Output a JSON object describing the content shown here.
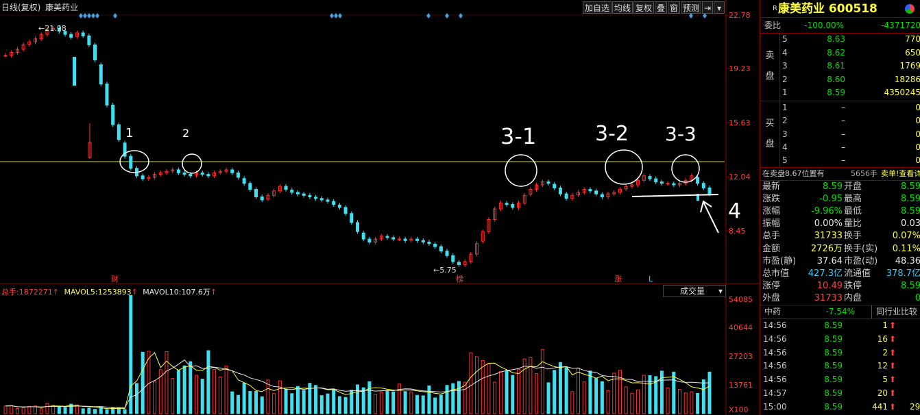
{
  "header": {
    "period_label": "日线(复权)",
    "stock_name": "康美药业",
    "buttons": [
      "加自选",
      "均线",
      "复权",
      "叠",
      "窗",
      "预测"
    ]
  },
  "price_axis": [
    "22.78",
    "19.23",
    "15.63",
    "12.04",
    "8.45"
  ],
  "volume_axis": [
    "54085",
    "40644",
    "27203",
    "13761",
    "X100"
  ],
  "annotations": {
    "high_label": "21.98",
    "low_label": "5.75",
    "marker_cai": "财",
    "marker_bang": "榜",
    "marker_zhang": "涨",
    "marker_l": "L",
    "hand_1": "1",
    "hand_2": "2",
    "hand_3_1": "3-1",
    "hand_3_2": "3-2",
    "hand_3_3": "3-3",
    "hand_4": "4"
  },
  "volume_header": {
    "total_label": "总手:",
    "total_value": "1872271",
    "mavol5_label": "MAVOL5:",
    "mavol5_value": "1253893",
    "mavol10_label": "MAVOL10:",
    "mavol10_value": "107.6万",
    "dropdown": "成交量"
  },
  "quote": {
    "badge": "R",
    "title": "康美药业 600518",
    "weibi_label": "委比",
    "weibi_pct": "-100.00%",
    "weibi_diff": "-4371720",
    "sell_side_label": [
      "卖",
      "盘"
    ],
    "buy_side_label": [
      "买",
      "盘"
    ],
    "sell": [
      {
        "level": "5",
        "price": "8.63",
        "vol": "770"
      },
      {
        "level": "4",
        "price": "8.62",
        "vol": "650"
      },
      {
        "level": "3",
        "price": "8.61",
        "vol": "1769"
      },
      {
        "level": "2",
        "price": "8.60",
        "vol": "18286"
      },
      {
        "level": "1",
        "price": "8.59",
        "vol": "4350245"
      }
    ],
    "buy": [
      {
        "level": "1",
        "price": "–",
        "vol": "0"
      },
      {
        "level": "2",
        "price": "–",
        "vol": "0"
      },
      {
        "level": "3",
        "price": "–",
        "vol": "0"
      },
      {
        "level": "4",
        "price": "–",
        "vol": "0"
      },
      {
        "level": "5",
        "price": "–",
        "vol": "0"
      }
    ],
    "order_info": "在卖盘8.67位置有",
    "order_vol": "5656手",
    "order_link": "卖单!查看详细",
    "stats": [
      {
        "l1": "最新",
        "v1": "8.59",
        "c1": "green",
        "l2": "开盘",
        "v2": "8.59",
        "c2": "green"
      },
      {
        "l1": "涨跌",
        "v1": "-0.95",
        "c1": "green",
        "l2": "最高",
        "v2": "8.59",
        "c2": "green"
      },
      {
        "l1": "涨幅",
        "v1": "-9.96%",
        "c1": "green",
        "l2": "最低",
        "v2": "8.59",
        "c2": "green"
      },
      {
        "l1": "振幅",
        "v1": "0.00%",
        "c1": "white",
        "l2": "量比",
        "v2": "0.03",
        "c2": "white"
      },
      {
        "l1": "总手",
        "v1": "31733",
        "c1": "yellow",
        "l2": "换手",
        "v2": "0.07%",
        "c2": "yellow"
      },
      {
        "l1": "金额",
        "v1": "2726万",
        "c1": "yellow",
        "l2": "换手(实)",
        "v2": "0.11%",
        "c2": "yellow"
      },
      {
        "l1": "市盈(静)",
        "v1": "37.64",
        "c1": "white",
        "l2": "市盈(动)",
        "v2": "48.36",
        "c2": "white"
      },
      {
        "l1": "总市值",
        "v1": "427.3亿",
        "c1": "cyan",
        "l2": "流通值",
        "v2": "378.7亿",
        "c2": "cyan"
      },
      {
        "l1": "涨停",
        "v1": "10.49",
        "c1": "red",
        "l2": "跌停",
        "v2": "8.59",
        "c2": "green"
      },
      {
        "l1": "外盘",
        "v1": "31733",
        "c1": "red",
        "l2": "内盘",
        "v2": "0",
        "c2": "green"
      }
    ],
    "sector_name": "中药",
    "sector_pct": "-7.54%",
    "sector_btn": "同行业比较",
    "ticks": [
      {
        "time": "14:56",
        "price": "8.59",
        "vol": "1"
      },
      {
        "time": "14:56",
        "price": "8.59",
        "vol": "16"
      },
      {
        "time": "14:56",
        "price": "8.59",
        "vol": "2"
      },
      {
        "time": "14:56",
        "price": "8.59",
        "vol": "12"
      },
      {
        "time": "14:56",
        "price": "8.59",
        "vol": "5"
      },
      {
        "time": "14:57",
        "price": "8.59",
        "vol": "20"
      },
      {
        "time": "15:00",
        "price": "8.59",
        "vol": "441"
      }
    ],
    "tick_extra": "29"
  },
  "colors": {
    "up": "#ff3030",
    "down": "#40e0f0",
    "hline": "#e0e000",
    "axis": "#8b0000",
    "axis_text": "#ff4040"
  }
}
